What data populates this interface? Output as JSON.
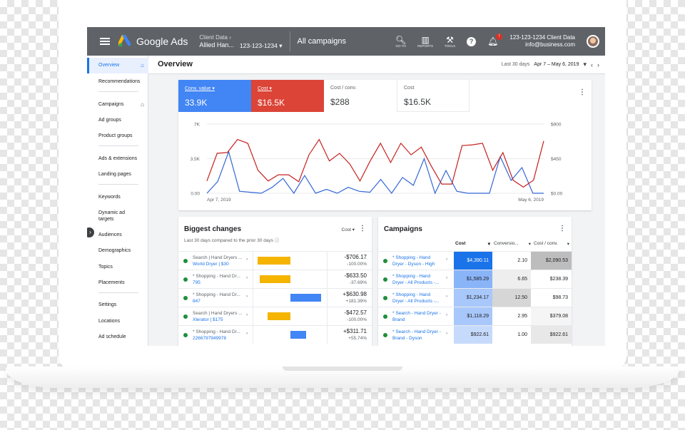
{
  "app": {
    "brand": "Google Ads",
    "account_label": "Client Data",
    "account_name": "Allied Han...",
    "account_id": "123-123-1234",
    "view_title": "All campaigns",
    "tools": [
      {
        "label": "GO TO",
        "icon": "search-icon"
      },
      {
        "label": "REPORTS",
        "icon": "reports-icon"
      },
      {
        "label": "TOOLS",
        "icon": "wrench-icon"
      }
    ],
    "notification_count": "!",
    "user_line1": "123-123-1234 Client Data",
    "user_line2": "info@business.com"
  },
  "sidebar": {
    "items": [
      {
        "label": "Overview",
        "active": true,
        "home": true
      },
      {
        "label": "Recommendations"
      },
      {
        "label": "Campaigns",
        "home": true
      },
      {
        "label": "Ad groups"
      },
      {
        "label": "Product groups"
      },
      {
        "label": "Ads & extensions"
      },
      {
        "label": "Landing pages"
      },
      {
        "label": "Keywords"
      },
      {
        "label": "Dynamic ad targets"
      },
      {
        "label": "Audiences"
      },
      {
        "label": "Demographics"
      },
      {
        "label": "Topics"
      },
      {
        "label": "Placements"
      },
      {
        "label": "Settings"
      },
      {
        "label": "Locations"
      },
      {
        "label": "Ad schedule"
      }
    ]
  },
  "overview": {
    "title": "Overview",
    "range_label": "Last 30 days",
    "range_value": "Apr 7 – May 6, 2019"
  },
  "metrics": [
    {
      "label": "Conv. value",
      "value": "33.9K",
      "color": "#4285f4",
      "selected": true
    },
    {
      "label": "Cost",
      "value": "$16.5K",
      "color": "#db4437",
      "selected": true
    },
    {
      "label": "Cost / conv.",
      "value": "$288"
    },
    {
      "label": "Cost",
      "value": "$16.5K"
    }
  ],
  "chart_data": {
    "type": "line",
    "x_start": "Apr 7, 2019",
    "x_end": "May 6, 2019",
    "left_axis_ticks": [
      "0.00",
      "3.5K",
      "7K"
    ],
    "right_axis_ticks": [
      "$0.00",
      "$450",
      "$900"
    ],
    "ylim_left": [
      0,
      7000
    ],
    "ylim_right": [
      0,
      900
    ],
    "grid": true,
    "series": [
      {
        "axis": "left",
        "color": "#3367d6",
        "values": [
          0,
          1200,
          4200,
          200,
          100,
          0,
          600,
          1500,
          0,
          1800,
          0,
          400,
          0,
          600,
          200,
          100,
          1400,
          0,
          1600,
          800,
          3500,
          0,
          2300,
          200,
          0,
          0,
          0,
          3700,
          1300,
          2600,
          0,
          0
        ]
      },
      {
        "axis": "right",
        "color": "#c5221f",
        "values": [
          160,
          520,
          530,
          700,
          650,
          300,
          160,
          240,
          240,
          150,
          500,
          700,
          420,
          520,
          380,
          160,
          420,
          650,
          400,
          650,
          500,
          600,
          350,
          120,
          120,
          620,
          630,
          650,
          300,
          530,
          170,
          80,
          170,
          680
        ]
      }
    ]
  },
  "biggest_changes": {
    "title": "Biggest changes",
    "subtitle": "Last 30 days compared to the prior 30 days",
    "sort_label": "Cost",
    "rows": [
      {
        "line1": "Search | Hand Dryers ...",
        "line2": "World Dryer | $30",
        "delta": "-$706.17",
        "pct": "-100.00%",
        "bar_fraction": -0.38,
        "bar_color": "#f4b400"
      },
      {
        "line1": "* Shopping - Hand Dr...",
        "line2": "795",
        "delta": "-$633.50",
        "pct": "-37.69%",
        "bar_fraction": -0.36,
        "bar_color": "#f4b400"
      },
      {
        "line1": "* Shopping - Hand Dr...",
        "line2": "847",
        "delta": "+$630.98",
        "pct": "+181.39%",
        "bar_fraction": 0.36,
        "bar_color": "#4285f4"
      },
      {
        "line1": "Search | Hand Dryers ...",
        "line2": "Xlerator | $175",
        "delta": "-$472.57",
        "pct": "-100.00%",
        "bar_fraction": -0.27,
        "bar_color": "#f4b400"
      },
      {
        "line1": "* Shopping - Hand Dr...",
        "line2": "2266797949978",
        "delta": "+$311.71",
        "pct": "+55.74%",
        "bar_fraction": 0.18,
        "bar_color": "#4285f4"
      }
    ]
  },
  "campaigns": {
    "title": "Campaigns",
    "columns": [
      "Cost",
      "Conversio...",
      "Cost / conv."
    ],
    "rows": [
      {
        "line1": "* Shopping - Hand",
        "line2": "Dryer - Dyson - High",
        "cost": "$4,390.11",
        "conv": "2.10",
        "cpc": "$2,090.53",
        "cost_color": "#1a73e8",
        "conv_color": "#ffffff",
        "cpc_color": "#bdbdbd"
      },
      {
        "line1": "* Shopping - Hand",
        "line2": "Dryer - All Products -...",
        "cost": "$1,585.29",
        "conv": "6.65",
        "cpc": "$238.39",
        "cost_color": "#8ab4f8",
        "conv_color": "#eeeeee",
        "cpc_color": "#ffffff"
      },
      {
        "line1": "* Shopping - Hand",
        "line2": "Dryer - All Products -...",
        "cost": "$1,234.17",
        "conv": "12.50",
        "cpc": "$98.73",
        "cost_color": "#a8c7fa",
        "conv_color": "#d6d6d6",
        "cpc_color": "#ffffff"
      },
      {
        "line1": "* Search - Hand Dryer -",
        "line2": "Brand",
        "cost": "$1,118.29",
        "conv": "2.95",
        "cpc": "$379.08",
        "cost_color": "#a8c7fa",
        "conv_color": "#ffffff",
        "cpc_color": "#f5f5f5"
      },
      {
        "line1": "* Search - Hand Dryer -",
        "line2": "Brand - Dyson",
        "cost": "$922.61",
        "conv": "1.00",
        "cpc": "$922.61",
        "cost_color": "#c6dafc",
        "conv_color": "#ffffff",
        "cpc_color": "#e8e8e8"
      }
    ]
  }
}
